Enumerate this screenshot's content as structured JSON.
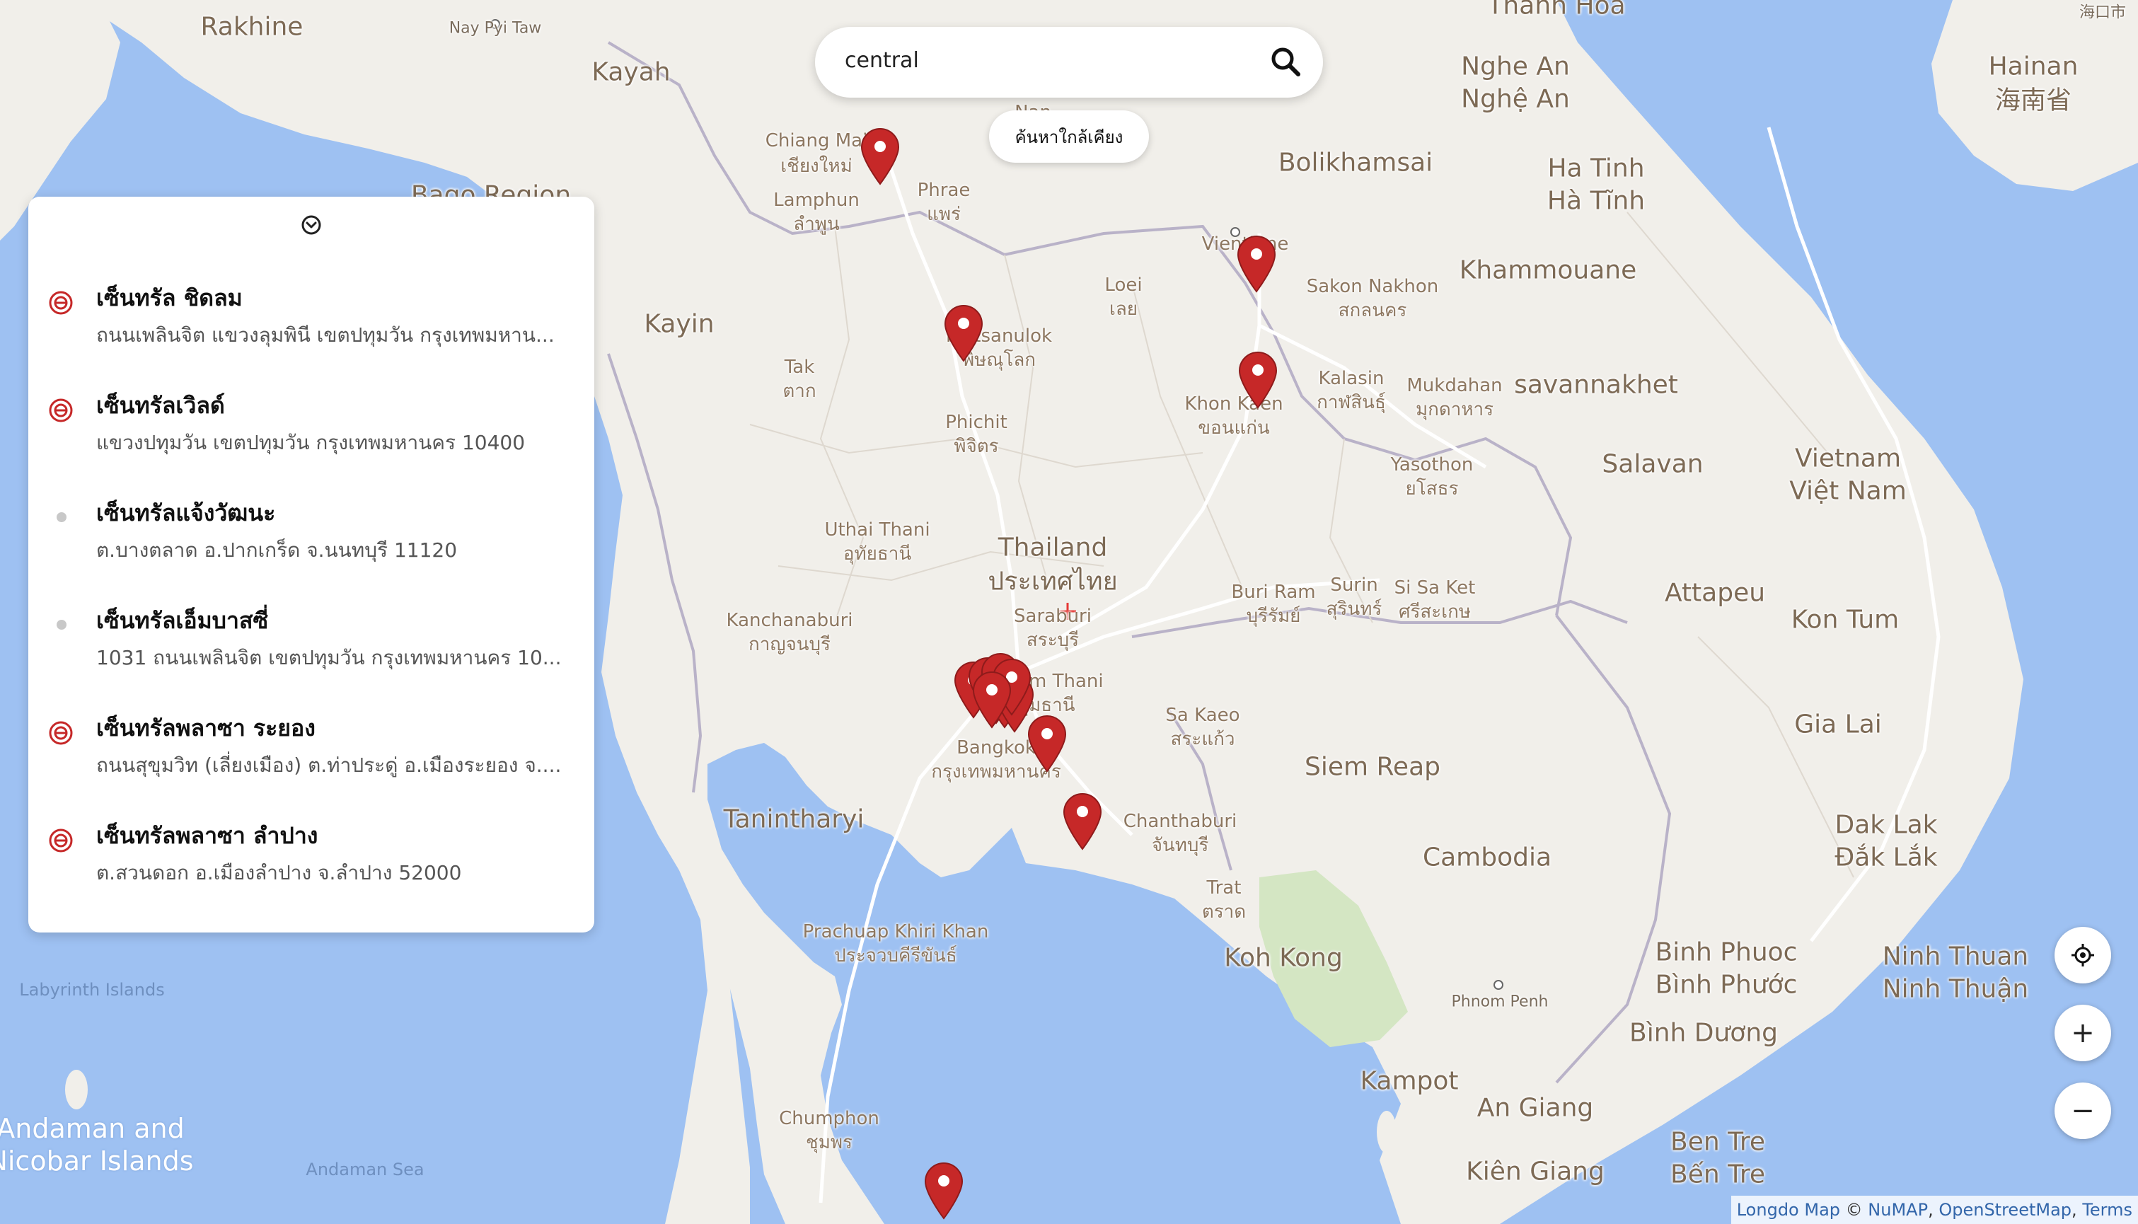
{
  "search": {
    "value": "central",
    "search_icon": "search-icon"
  },
  "nearby_button": {
    "label": "ค้นหาใกล้เคียง"
  },
  "panel": {
    "toggle_icon": "chevron-down-circle-icon",
    "results": [
      {
        "name": "เซ็นทรัล ชิดลม",
        "address": "ถนนเพลินจิต แขวงลุมพินี เขตปทุมวัน กรุงเทพมหาน...",
        "icon": "central-logo-icon"
      },
      {
        "name": "เซ็นทรัลเวิลด์",
        "address": "แขวงปทุมวัน เขตปทุมวัน กรุงเทพมหานคร 10400",
        "icon": "central-logo-icon"
      },
      {
        "name": "เซ็นทรัลแจ้งวัฒนะ",
        "address": "ต.บางตลาด อ.ปากเกร็ด จ.นนทบุรี 11120",
        "icon": "dot-icon"
      },
      {
        "name": "เซ็นทรัลเอ็มบาสซี่",
        "address": "1031 ถนนเพลินจิต เขตปทุมวัน กรุงเทพมหานคร 10...",
        "icon": "dot-icon"
      },
      {
        "name": "เซ็นทรัลพลาซา ระยอง",
        "address": "ถนนสุขุมวิท (เลี่ยงเมือง) ต.ท่าประดู่ อ.เมืองระยอง จ....",
        "icon": "central-logo-icon"
      },
      {
        "name": "เซ็นทรัลพลาซา ลำปาง",
        "address": "ต.สวนดอก อ.เมืองลำปาง จ.ลำปาง 52000",
        "icon": "central-logo-icon"
      }
    ]
  },
  "controls": {
    "locate_icon": "locate-icon",
    "zoom_in": "+",
    "zoom_out": "−"
  },
  "attribution": {
    "longdo": "Longdo Map",
    "copy": "©",
    "numap": "NuMAP",
    "osm": "OpenStreetMap",
    "terms": "Terms",
    "comma": ","
  },
  "map_labels": {
    "rakhine": "Rakhine",
    "nay_pyi_taw": "Nay Pyi Taw",
    "kayah": "Kayah",
    "bago": "Bago Region",
    "kayin": "Kayin",
    "thanh_hoa": "Thanh Hoa",
    "haikou": "海口市",
    "hainan": "Hainan",
    "hainan_cn": "海南省",
    "nghe_an": "Nghe An",
    "nghe_an_vn": "Nghệ An",
    "bolikhamsai": "Bolikhamsai",
    "ha_tinh": "Ha Tinh",
    "ha_tinh_vn": "Hà Tĩnh",
    "khammouane": "Khammouane",
    "chiang_mai": "Chiang Mai",
    "chiang_mai_th": "เชียงใหม่",
    "lamphun": "Lamphun",
    "lamphun_th": "ลำพูน",
    "phrae": "Phrae",
    "phrae_th": "แพร่",
    "nan": "Nan",
    "vientiane": "Vientiane",
    "sakon": "Sakon Nakhon",
    "sakon_th": "สกลนคร",
    "loei": "Loei",
    "loei_th": "เลย",
    "phitsanulok": "Phitsanulok",
    "phitsanulok_th": "พิษณุโลก",
    "tak": "Tak",
    "tak_th": "ตาก",
    "kalasin": "Kalasin",
    "kalasin_th": "กาฬสินธุ์",
    "mukdahan": "Mukdahan",
    "mukdahan_th": "มุกดาหาร",
    "savannakhet": "savannakhet",
    "khon_kaen": "Khon Kaen",
    "khon_kaen_th": "ขอนแก่น",
    "phichit": "Phichit",
    "phichit_th": "พิจิตร",
    "vietnam": "Vietnam",
    "vietnam_vn": "Việt Nam",
    "salavan": "Salavan",
    "yasothon": "Yasothon",
    "yasothon_th": "ยโสธร",
    "uthai": "Uthai Thani",
    "uthai_th": "อุทัยธานี",
    "thailand": "Thailand",
    "thailand_th": "ประเทศไทย",
    "buri_ram": "Buri Ram",
    "buri_ram_th": "บุรีรัมย์",
    "surin": "Surin",
    "surin_th": "สุรินทร์",
    "si_sa_ket": "Si Sa Ket",
    "si_sa_ket_th": "ศรีสะเกษ",
    "attapeu": "Attapeu",
    "kon_tum": "Kon Tum",
    "kanchanaburi": "Kanchanaburi",
    "kanchanaburi_th": "กาญจนบุรี",
    "saraburi": "Saraburi",
    "saraburi_th": "สระบุรี",
    "pathum": "Pathum Thani",
    "pathum_th": "ปทุมธานี",
    "sa_kaeo": "Sa Kaeo",
    "sa_kaeo_th": "สระแก้ว",
    "siem_reap": "Siem Reap",
    "gia_lai": "Gia Lai",
    "bangkok": "Bangkok",
    "bangkok_th": "กรุงเทพมหานคร",
    "tanintharyi": "Tanintharyi",
    "chanthaburi": "Chanthaburi",
    "chanthaburi_th": "จันทบุรี",
    "cambodia": "Cambodia",
    "dak_lak": "Dak Lak",
    "dak_lak_vn": "Đắk Lắk",
    "trat": "Trat",
    "trat_th": "ตราด",
    "prachuap": "Prachuap Khiri Khan",
    "prachuap_th": "ประจวบคีรีขันธ์",
    "koh_kong": "Koh Kong",
    "labyrinth": "Labyrinth Islands",
    "binh_phuoc": "Binh Phuoc",
    "binh_phuoc_vn": "Bình Phước",
    "ninh_thuan": "Ninh Thuan",
    "ninh_thuan_vn": "Ninh Thuận",
    "phnom_penh": "Phnom Penh",
    "binh_duong": "Bình Dương",
    "kampot": "Kampot",
    "an_giang": "An Giang",
    "ben_tre": "Ben Tre",
    "ben_tre_vn": "Bến Tre",
    "kien_giang": "Kiên Giang",
    "andaman": "Andaman and",
    "nicobar": "Nicobar Islands",
    "andaman_sea": "Andaman Sea",
    "chumphon": "Chumphon",
    "chumphon_th": "ชุมพร"
  },
  "colors": {
    "water": "#9ec1f2",
    "land": "#f1efea",
    "pin": "#c62828",
    "park": "#d4e6c3",
    "link": "#3366aa"
  }
}
